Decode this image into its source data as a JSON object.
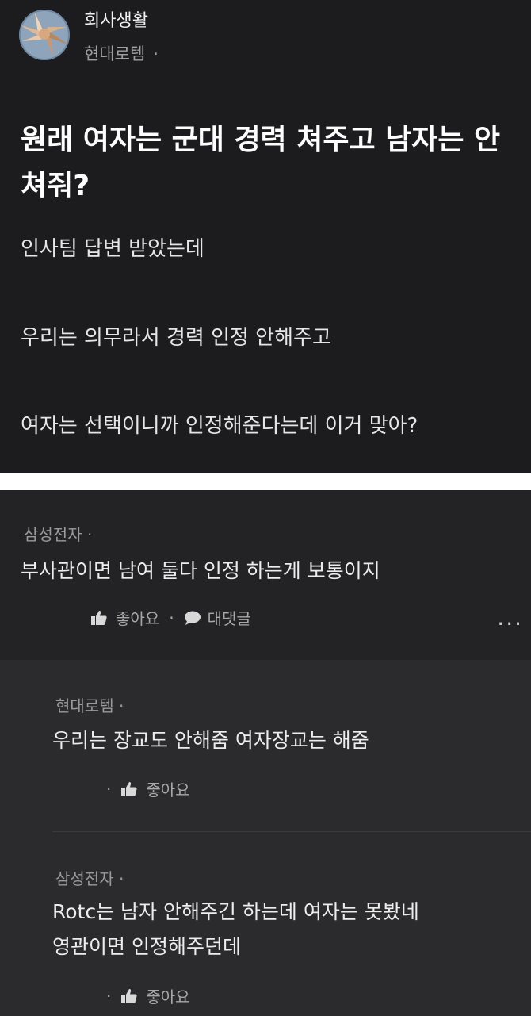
{
  "post": {
    "channel": "회사생활",
    "company": "현대로템",
    "company_dot": "·",
    "title": "원래 여자는 군대 경력 쳐주고 남자는 안쳐줘?",
    "body": [
      "인사팀 답변 받았는데",
      "우리는 의무라서 경력 인정 안해주고",
      "여자는 선택이니까 인정해준다는데 이거 맞아?"
    ]
  },
  "comments": [
    {
      "author": "삼성전자 ·",
      "text": "부사관이면 남여 둘다 인정 하는게 보통이지",
      "like_label": "좋아요",
      "reply_label": "대댓글",
      "sep": "·",
      "more": "···"
    }
  ],
  "replies": [
    {
      "author": "현대로템 ·",
      "text": [
        "우리는 장교도 안해줌 여자장교는 해줌"
      ],
      "dot": "·",
      "like_label": "좋아요"
    },
    {
      "author": "삼성전자 ·",
      "text": [
        "Rotc는 남자 안해주긴 하는데 여자는 못봤네",
        "영관이면 인정해주던데"
      ],
      "dot": "·",
      "like_label": "좋아요"
    }
  ],
  "icons": {
    "avatar": "teamwork-hands-avatar",
    "like": "thumbs-up-icon",
    "reply": "speech-bubble-icon",
    "more": "more-options-icon"
  },
  "colors": {
    "post_bg": "#1c1c1e",
    "comment_bg": "#232325",
    "reply_bg": "#2b2b2d",
    "text": "#ececec",
    "muted": "#9a9a9a"
  }
}
